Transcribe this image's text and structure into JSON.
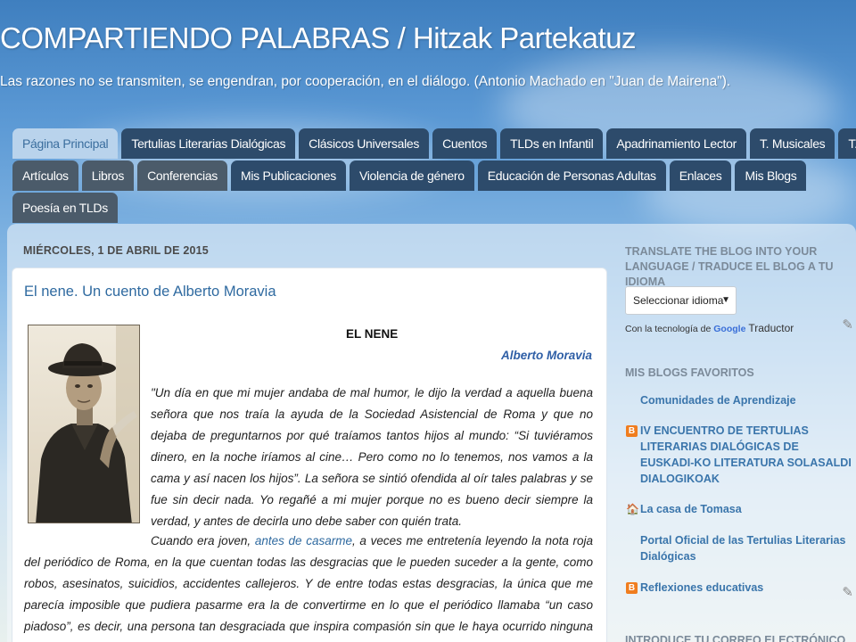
{
  "blog": {
    "title": "COMPARTIENDO PALABRAS / Hitzak Partekatuz",
    "description": "Las razones no se transmiten, se engendran, por cooperación, en el diálogo. (Antonio Machado en \"Juan de Mairena\")."
  },
  "nav": {
    "row1": [
      "Página Principal",
      "Tertulias Literarias Dialógicas",
      "Clásicos Universales",
      "Cuentos",
      "TLDs en Infantil",
      "Apadrinamiento Lector",
      "T. Musicales",
      "T. Arte"
    ],
    "row2": [
      "Artículos",
      "Libros",
      "Conferencias",
      "Mis Publicaciones",
      "Violencia de género",
      "Educación de Personas Adultas",
      "Enlaces",
      "Mis Blogs"
    ],
    "row3": [
      "Poesía en TLDs"
    ]
  },
  "post": {
    "date": "MIÉRCOLES, 1 DE ABRIL DE 2015",
    "title": "El nene. Un cuento de Alberto Moravia",
    "heading": "EL NENE",
    "author": "Alberto Moravia",
    "para1": "\"Un día en que mi mujer andaba de mal humor, le dijo la verdad a aquella buena señora que nos traía la ayuda de la Sociedad Asistencial de Roma y que no dejaba de preguntarnos por qué traíamos tantos hijos al mundo: “Si tuviéramos dinero, en la noche iríamos al cine… Pero como no lo tenemos, nos vamos a la cama y así nacen los hijos”. La señora se sintió ofendida al oír tales palabras y se fue sin decir nada. Yo regañé a mi mujer porque no es bueno decir siempre la verdad, y antes de decirla uno debe saber con quién trata.",
    "para2_before": "Cuando era joven, ",
    "para2_link": "antes de casarme",
    "para2_after": ", a veces me entretenía leyendo la nota roja del periódico de Roma, en la que cuentan todas las desgracias que le pueden suceder a la gente, como robos, asesinatos, suicidios, accidentes callejeros. Y de entre todas estas desgracias, la única que me parecía imposible que pudiera pasarme era la de convertirme en lo que el periódico llamaba “un caso piadoso”, es decir, una persona tan desgraciada que inspira compasión sin que le haya ocurrido ninguna desgracia en especial, sino así sin más, por el solo hecho de"
  },
  "sidebar": {
    "translate_title": "TRANSLATE THE BLOG INTO YOUR LANGUAGE / TRADUCE EL BLOG A TU IDIOMA",
    "select_label": "Seleccionar idioma",
    "powered_prefix": "Con la tecnología de",
    "powered_google": "Google",
    "powered_suffix": "Traductor",
    "favorites_title": "MIS BLOGS FAVORITOS",
    "blogs": [
      {
        "label": "Comunidades de Aprendizaje",
        "icon": "none"
      },
      {
        "label": "IV ENCUENTRO DE TERTULIAS LITERARIAS DIALÓGICAS DE EUSKADI-KO LITERATURA SOLASALDI DIALOGIKOAK",
        "icon": "blogger-icon"
      },
      {
        "label": "La casa de Tomasa",
        "icon": "favicon-icon"
      },
      {
        "label": "Portal Oficial de las Tertulias Literarias Dialógicas",
        "icon": "none"
      },
      {
        "label": "Reflexiones educativas",
        "icon": "blogger-icon"
      }
    ],
    "email_title": "INTRODUCE TU CORREO ELECTRÓNICO PARA"
  },
  "colors": {
    "tab_bg": "#2d4b6b",
    "tab_active_bg": "#b9d3ec",
    "link": "#2f6aa0",
    "sidebar_title": "#7b8a99",
    "blogger_orange": "#f07d1f"
  }
}
